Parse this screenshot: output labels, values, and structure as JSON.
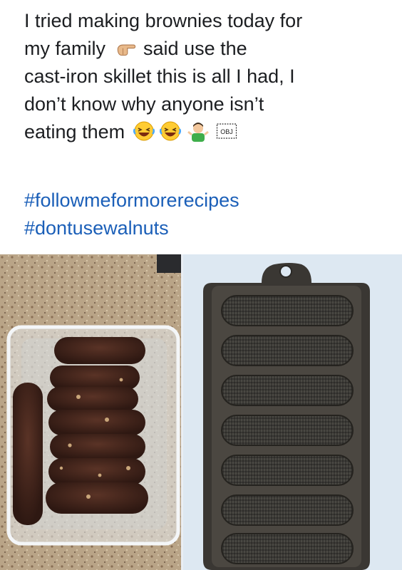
{
  "post": {
    "lines": [
      "I tried making brownies today for",
      "my family",
      "said use the",
      "cast-iron skillet this is all I had, I",
      "don’t know why anyone  isn’t",
      "eating them"
    ],
    "emoji_icons": [
      "pointing-hand-icon",
      "laughing-face-icon",
      "laughing-face-icon",
      "man-shrugging-icon",
      "obj-box-icon"
    ],
    "obj_label": "OBJ"
  },
  "hashtags": [
    "#followmeformorerecipes",
    "#dontusewalnuts"
  ],
  "colors": {
    "text": "#1c1e21",
    "hashtag": "#1b5fb8"
  },
  "images": {
    "left": "brownies-in-plastic-container",
    "right": "cast-iron-cornbread-pan"
  }
}
